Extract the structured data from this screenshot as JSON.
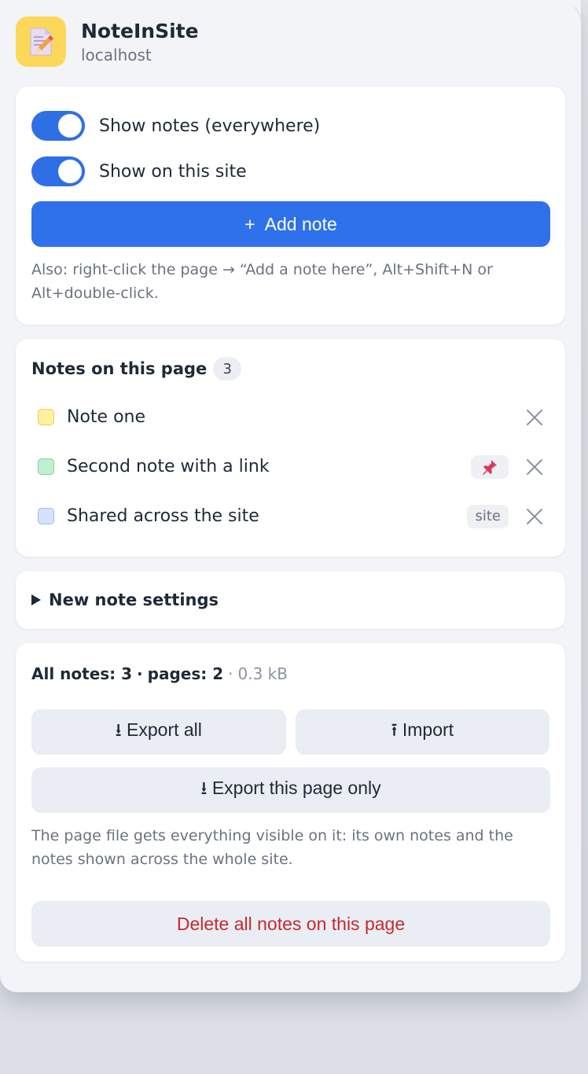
{
  "app": {
    "title": "NoteInSite",
    "site": "localhost",
    "logo_icon": "note-pencil-icon"
  },
  "toggles": [
    {
      "label": "Show notes (everywhere)",
      "on": true
    },
    {
      "label": "Show on this site",
      "on": true
    }
  ],
  "add_button": {
    "icon": "+",
    "label": "Add note"
  },
  "hint": "Also: right-click the page → “Add a note here”, Alt+Shift+N or Alt+double-click.",
  "notes_section": {
    "title": "Notes on this page",
    "count": "3",
    "notes": [
      {
        "label": "Note one",
        "color": "#fdf0a0",
        "tag": ""
      },
      {
        "label": "Second note with a link",
        "color": "#bff0cf",
        "tag": "pin-icon"
      },
      {
        "label": "Shared across the site",
        "color": "#d4e3fb",
        "tag": "site"
      }
    ]
  },
  "settings": {
    "label": "New note settings"
  },
  "storage": {
    "all_notes": "All notes: 3",
    "pages": "pages: 2",
    "size": "0.3 kB",
    "export_all": "⭳ Export all",
    "import": "⭱ Import",
    "export_page": "⭳ Export this page only",
    "page_hint": "The page file gets everything visible on it: its own notes and the notes shown across the whole site.",
    "delete_all": "Delete all notes on this page"
  },
  "colors": {
    "accent": "#2f71ea",
    "danger": "#c42b2b",
    "logo_bg": "#fcd85a"
  }
}
